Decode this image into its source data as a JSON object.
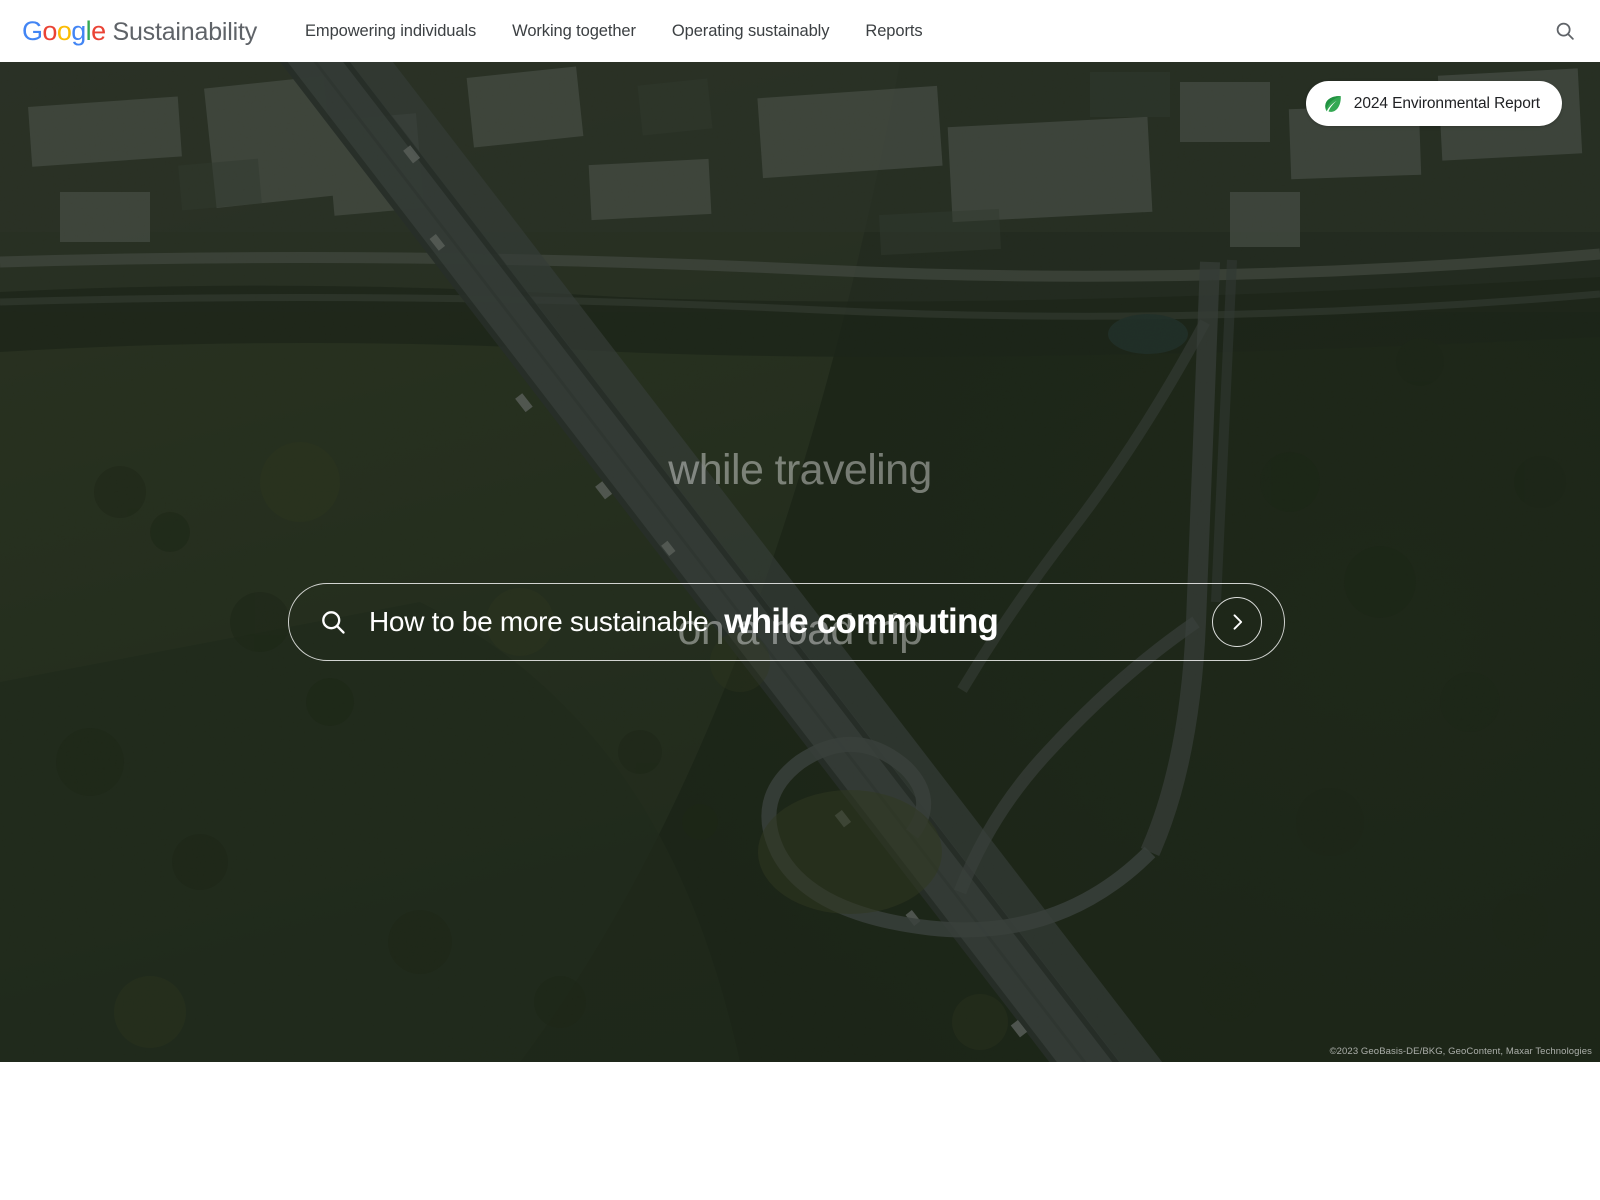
{
  "header": {
    "brand": {
      "logo_letters": [
        {
          "char": "G",
          "color": "#4285F4"
        },
        {
          "char": "o",
          "color": "#EA4335"
        },
        {
          "char": "o",
          "color": "#FBBC05"
        },
        {
          "char": "g",
          "color": "#4285F4"
        },
        {
          "char": "l",
          "color": "#34A853"
        },
        {
          "char": "e",
          "color": "#EA4335"
        }
      ],
      "product": "Sustainability"
    },
    "nav": [
      {
        "label": "Empowering individuals"
      },
      {
        "label": "Working together"
      },
      {
        "label": "Operating sustainably"
      },
      {
        "label": "Reports"
      }
    ],
    "search_icon": "search-icon"
  },
  "hero": {
    "report_pill": {
      "icon": "leaf-icon",
      "label": "2024 Environmental Report"
    },
    "phrase_above": "while traveling",
    "phrase_below": "on a road trip",
    "search": {
      "icon": "search-icon",
      "prompt": "How to be more sustainable",
      "active_phrase": "while commuting",
      "submit_icon": "chevron-right-icon"
    },
    "attribution": "©2023 GeoBasis-DE/BKG, GeoContent, Maxar Technologies",
    "colors": {
      "scrim": "#10160e",
      "pill_border": "#ffffff",
      "leaf_green": "#34A853",
      "nav_text": "#3c4043"
    }
  }
}
